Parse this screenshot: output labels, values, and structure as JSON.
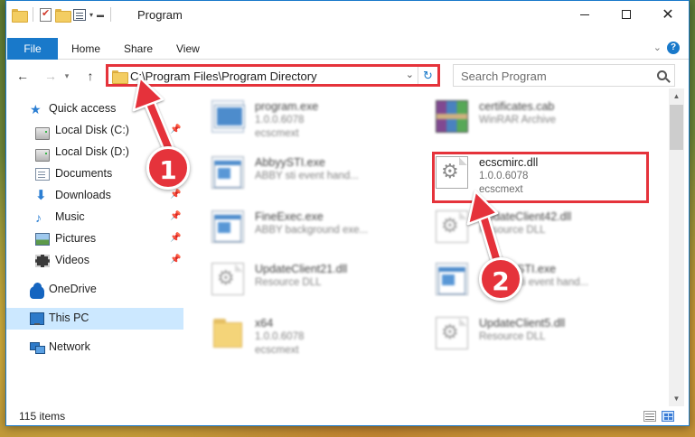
{
  "window": {
    "title": "Program",
    "controls": {
      "minimize": "minimize",
      "maximize": "maximize",
      "close": "✕"
    }
  },
  "ribbon": {
    "tabs": [
      {
        "label": "File",
        "active": true
      },
      {
        "label": "Home"
      },
      {
        "label": "Share"
      },
      {
        "label": "View"
      }
    ],
    "help": "?"
  },
  "address_bar": {
    "path": "C:\\Program Files\\Program Directory",
    "search_placeholder": "Search Program"
  },
  "sidebar": {
    "items": [
      {
        "label": "Quick access",
        "icon": "star-icon"
      },
      {
        "label": "Local Disk (C:)",
        "icon": "drive-icon",
        "pinned": true
      },
      {
        "label": "Local Disk (D:)",
        "icon": "drive-icon"
      },
      {
        "label": "Documents",
        "icon": "documents-icon",
        "pinned": true
      },
      {
        "label": "Downloads",
        "icon": "downloads-icon",
        "pinned": true
      },
      {
        "label": "Music",
        "icon": "music-icon",
        "pinned": true
      },
      {
        "label": "Pictures",
        "icon": "pictures-icon",
        "pinned": true
      },
      {
        "label": "Videos",
        "icon": "videos-icon",
        "pinned": true
      },
      {
        "label": "OneDrive",
        "icon": "onedrive-icon"
      },
      {
        "label": "This PC",
        "icon": "this-pc-icon",
        "selected": true
      },
      {
        "label": "Network",
        "icon": "network-icon"
      }
    ]
  },
  "files": [
    {
      "name": "program.exe",
      "desc": "1.0.0.6078",
      "sub": "ecscmext",
      "icon": "exe-icon"
    },
    {
      "name": "certificates.cab",
      "desc": "WinRAR Archive",
      "sub": "",
      "icon": "winrar-icon"
    },
    {
      "name": "AbbyySTI.exe",
      "desc": "ABBY sti event hand...",
      "sub": "",
      "icon": "application-icon"
    },
    {
      "name": "ecscmirc.dll",
      "desc": "1.0.0.6078",
      "sub": "ecscmext",
      "icon": "dll-icon",
      "highlighted": true
    },
    {
      "name": "FineExec.exe",
      "desc": "ABBY background exe...",
      "sub": "",
      "icon": "application-icon"
    },
    {
      "name": "UpdateClient42.dll",
      "desc": "Resource DLL",
      "sub": "",
      "icon": "dll-icon"
    },
    {
      "name": "UpdateClient21.dll",
      "desc": "Resource DLL",
      "sub": "",
      "icon": "dll-icon"
    },
    {
      "name": "STI.exe",
      "desc": "sti event hand...",
      "sub": "",
      "icon": "application-icon"
    },
    {
      "name": "x64",
      "desc": "1.0.0.6078",
      "sub": "ecscmext",
      "icon": "folder-icon"
    },
    {
      "name": "UpdateClient5.dll",
      "desc": "Resource DLL",
      "sub": "",
      "icon": "dll-icon"
    }
  ],
  "status": {
    "item_count": "115 items"
  },
  "annotations": {
    "step1": "1",
    "step2": "2"
  },
  "colors": {
    "accent": "#1979ca",
    "highlight": "#e5333b",
    "selected": "#cce8ff"
  }
}
